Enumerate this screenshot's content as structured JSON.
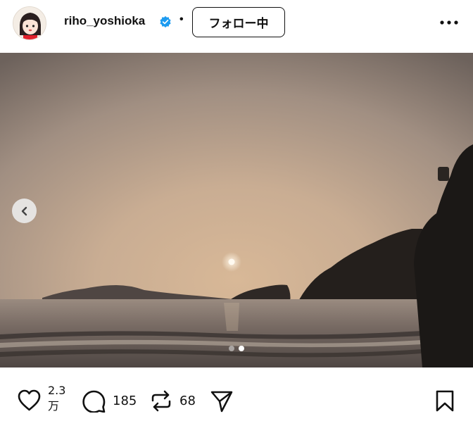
{
  "header": {
    "username": "riho_yoshioka",
    "separator": "•",
    "follow_label": "フォロー中",
    "verified_icon": "verified-badge-icon",
    "more_icon": "more-horizontal-icon"
  },
  "post": {
    "image_alt": "sunset over sea with islands",
    "carousel": {
      "total": 2,
      "current": 2
    }
  },
  "actions": {
    "likes_line1": "2.3",
    "likes_line2": "万",
    "comments": "185",
    "reposts": "68",
    "icons": [
      "heart-icon",
      "comment-icon",
      "repost-icon",
      "share-icon",
      "bookmark-icon"
    ]
  },
  "colors": {
    "verified": "#1d9bf0",
    "text": "#111111"
  }
}
